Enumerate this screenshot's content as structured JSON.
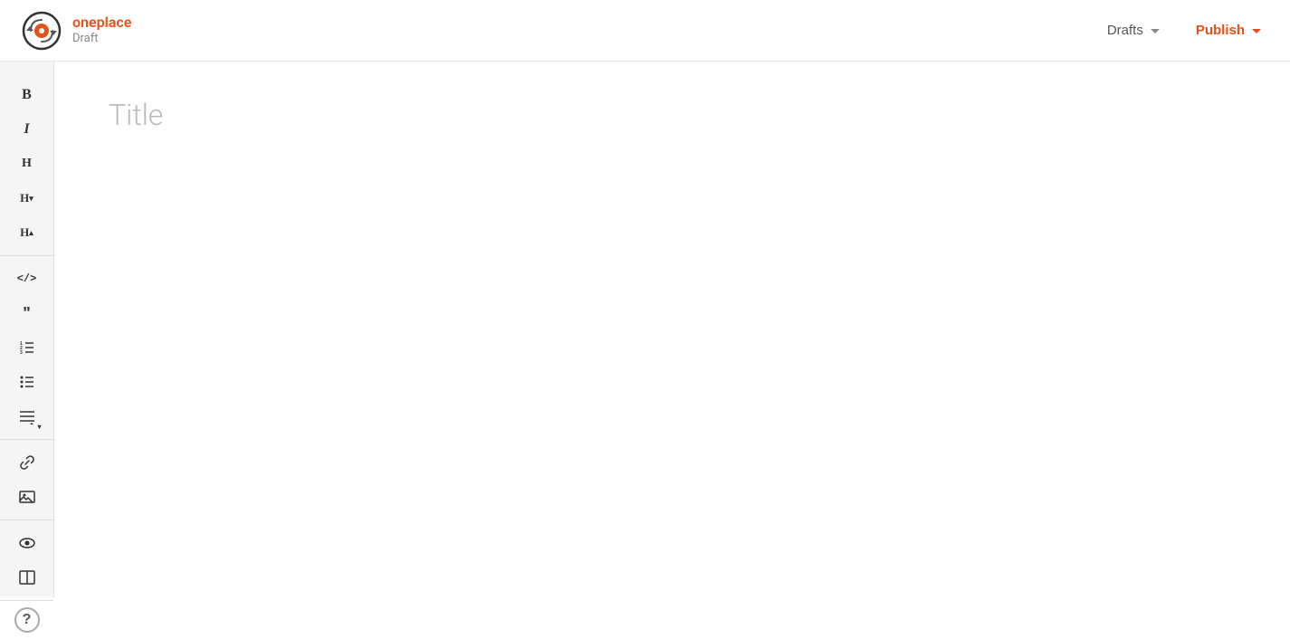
{
  "header": {
    "brand_name": "oneplace",
    "brand_status": "Draft",
    "drafts_label": "Drafts",
    "publish_label": "Publish"
  },
  "toolbar": {
    "groups": [
      {
        "id": "text-formatting",
        "buttons": [
          {
            "id": "bold",
            "label": "B",
            "icon_class": "bold",
            "title": "Bold"
          },
          {
            "id": "italic",
            "label": "I",
            "icon_class": "italic",
            "title": "Italic"
          },
          {
            "id": "heading1",
            "label": "H",
            "title": "Heading 1"
          },
          {
            "id": "heading2",
            "label": "H▾",
            "title": "Heading 2",
            "has_chevron": true
          },
          {
            "id": "heading3",
            "label": "H▴",
            "title": "Heading 3",
            "has_chevron": true
          }
        ]
      },
      {
        "id": "blocks",
        "buttons": [
          {
            "id": "code",
            "label": "</>",
            "title": "Code"
          },
          {
            "id": "blockquote",
            "label": "““",
            "title": "Blockquote"
          },
          {
            "id": "ordered-list",
            "label": "≡☛",
            "title": "Ordered List"
          },
          {
            "id": "unordered-list",
            "label": "≡",
            "title": "Unordered List"
          },
          {
            "id": "align",
            "label": "≡▾",
            "title": "Align",
            "has_chevron": true
          }
        ]
      },
      {
        "id": "insert",
        "buttons": [
          {
            "id": "link",
            "label": "🔗",
            "title": "Link"
          },
          {
            "id": "image",
            "label": "🖼",
            "title": "Image"
          }
        ]
      },
      {
        "id": "view",
        "buttons": [
          {
            "id": "preview",
            "label": "👁",
            "title": "Preview"
          },
          {
            "id": "split",
            "label": "⊟",
            "title": "Split View"
          }
        ]
      },
      {
        "id": "help",
        "buttons": [
          {
            "id": "help",
            "label": "?",
            "title": "Help"
          }
        ]
      }
    ]
  },
  "editor": {
    "title_placeholder": "Title"
  }
}
